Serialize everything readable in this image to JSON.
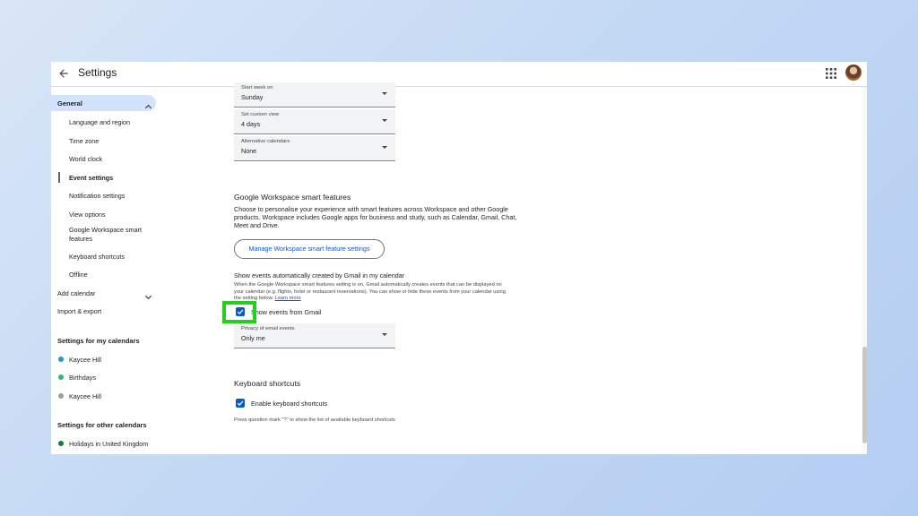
{
  "header": {
    "title": "Settings"
  },
  "sidebar": {
    "general": "General",
    "general_items": [
      "Language and region",
      "Time zone",
      "World clock",
      "Event settings",
      "Notification settings",
      "View options",
      "Google Workspace smart features",
      "Keyboard shortcuts",
      "Offline"
    ],
    "active_item": "Event settings",
    "add_calendar": "Add calendar",
    "import_export": "Import & export",
    "my_calendars_title": "Settings for my calendars",
    "my_calendars": [
      {
        "name": "Kaycee Hill",
        "color": "#1a9bc8"
      },
      {
        "name": "Birthdays",
        "color": "#33b679"
      },
      {
        "name": "Kaycee Hill",
        "color": "#9e9e9e"
      }
    ],
    "other_calendars_title": "Settings for other calendars",
    "other_calendars": [
      {
        "name": "Holidays in United Kingdom",
        "color": "#0b8043"
      }
    ]
  },
  "main": {
    "dropdowns": [
      {
        "label": "Start week on",
        "value": "Sunday"
      },
      {
        "label": "Set custom view",
        "value": "4 days"
      },
      {
        "label": "Alternative calendars",
        "value": "None"
      }
    ],
    "workspace": {
      "title": "Google Workspace smart features",
      "description": "Choose to personalise your experience with smart features across Workspace and other Google products. Workspace includes Google apps for business and study, such as Calendar, Gmail, Chat, Meet and Drive.",
      "button": "Manage Workspace smart feature settings"
    },
    "gmail_events": {
      "title": "Show events automatically created by Gmail in my calendar",
      "description": "When the Google Workspace smart features setting is on, Gmail automatically creates events that can be displayed on your calendar (e.g. flights, hotel or restaurant reservations). You can show or hide these events from your calendar using the setting below.",
      "learn_more": "Learn more",
      "checkbox_label": "Show events from Gmail",
      "privacy_dropdown": {
        "label": "Privacy of email events",
        "value": "Only me"
      }
    },
    "keyboard": {
      "title": "Keyboard shortcuts",
      "checkbox_label": "Enable keyboard shortcuts",
      "hint": "Press question mark \"?\" to show the list of available keyboard shortcuts"
    }
  },
  "colors": {
    "accent": "#0b57d0",
    "highlight": "#22d11e",
    "selected_bg": "#d3e3fd"
  }
}
